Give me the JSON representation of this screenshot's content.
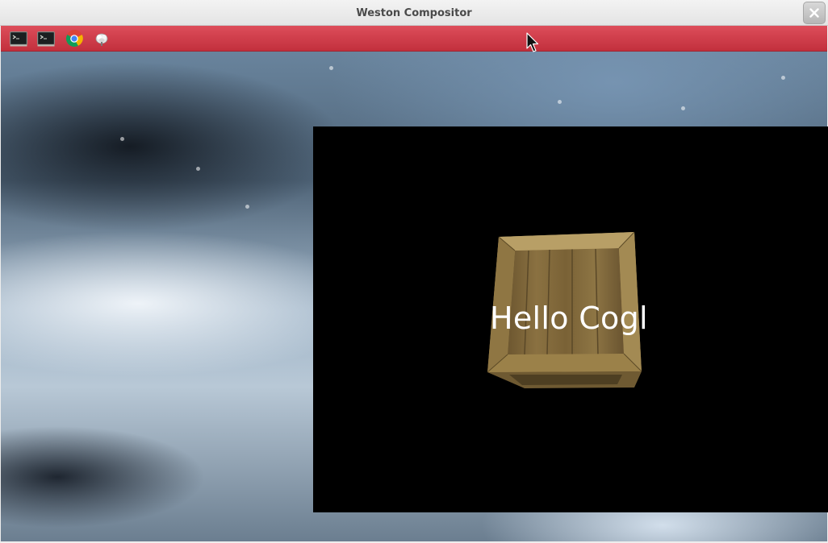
{
  "window": {
    "title": "Weston Compositor"
  },
  "panel": {
    "color": "#d03c49",
    "launchers": [
      {
        "icon": "terminal-icon"
      },
      {
        "icon": "terminal-icon"
      },
      {
        "icon": "chrome-icon"
      },
      {
        "icon": "flower-icon"
      }
    ]
  },
  "app_window": {
    "text": "Hello Cogl",
    "background": "#000000",
    "object": "wooden-crate"
  }
}
